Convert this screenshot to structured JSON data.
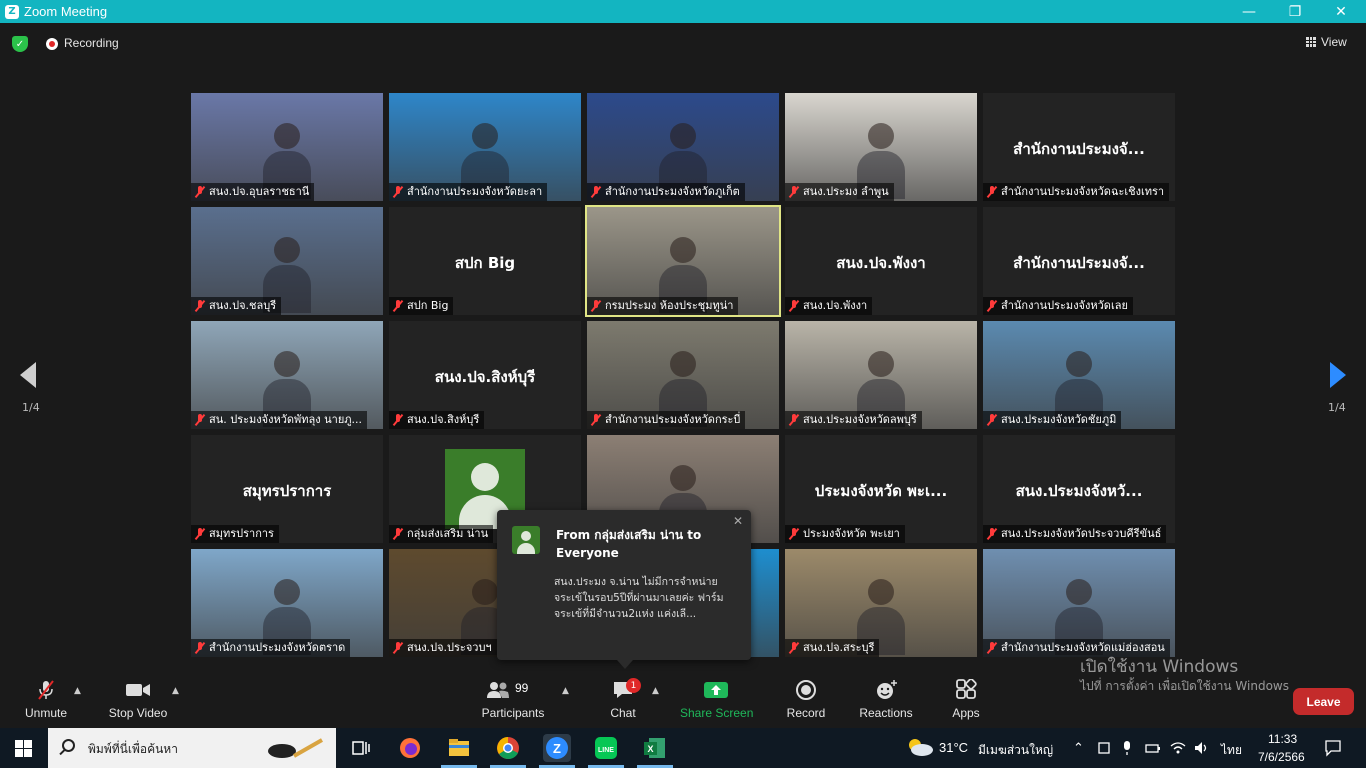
{
  "window": {
    "title": "Zoom Meeting"
  },
  "topbar": {
    "recording_label": "Recording",
    "view_label": "View"
  },
  "tiles": [
    {
      "label": "สนง.ปจ.อุบลราชธานี",
      "type": "video",
      "bg": "#6a78a8",
      "name_center": ""
    },
    {
      "label": "สำนักงานประมงจังหวัดยะลา",
      "type": "video",
      "bg": "#2e86c9",
      "name_center": ""
    },
    {
      "label": "สำนักงานประมงจังหวัดภูเก็ต",
      "type": "video",
      "bg": "#2c4a8c",
      "name_center": ""
    },
    {
      "label": "สนง.ประมง ลำพูน",
      "type": "video",
      "bg": "#d9d6cf",
      "name_center": ""
    },
    {
      "label": "สำนักงานประมงจังหวัดฉะเชิงเทรา",
      "type": "name",
      "bg": "#232323",
      "name_center": "สำนักงานประมงจั..."
    },
    {
      "label": "สนง.ปจ.ชลบุรี",
      "type": "video",
      "bg": "#5a6f8e",
      "name_center": ""
    },
    {
      "label": "สปก Big",
      "type": "name",
      "bg": "#232323",
      "name_center": "สปก Big"
    },
    {
      "label": "กรมประมง ห้องประชุมทูน่า",
      "type": "video",
      "bg": "#9b9689",
      "name_center": ""
    },
    {
      "label": "สนง.ปจ.พังงา",
      "type": "name",
      "bg": "#232323",
      "name_center": "สนง.ปจ.พังงา"
    },
    {
      "label": "สำนักงานประมงจังหวัดเลย",
      "type": "name",
      "bg": "#232323",
      "name_center": "สำนักงานประมงจั..."
    },
    {
      "label": "สน. ประมงจังหวัดพัทลุง นายภู...",
      "type": "video",
      "bg": "#8fa6b8",
      "name_center": ""
    },
    {
      "label": "สนง.ปจ.สิงห์บุรี",
      "type": "name",
      "bg": "#232323",
      "name_center": "สนง.ปจ.สิงห์บุรี"
    },
    {
      "label": "สำนักงานประมงจังหวัดกระบี่",
      "type": "video",
      "bg": "#7d7a6e",
      "name_center": ""
    },
    {
      "label": "สนง.ประมงจังหวัดลพบุรี",
      "type": "video",
      "bg": "#b9b4a8",
      "name_center": ""
    },
    {
      "label": "สนง.ประมงจังหวัดชัยภูมิ",
      "type": "video",
      "bg": "#5b8ab0",
      "name_center": ""
    },
    {
      "label": "สมุทรปราการ",
      "type": "name",
      "bg": "#232323",
      "name_center": "สมุทรปราการ"
    },
    {
      "label": "กลุ่มส่งเสริม น่าน",
      "type": "avatar",
      "bg": "#232323",
      "name_center": ""
    },
    {
      "label": "",
      "type": "video",
      "bg": "#8c7f74",
      "name_center": ""
    },
    {
      "label": "ประมงจังหวัด พะเยา",
      "type": "name",
      "bg": "#232323",
      "name_center": "ประมงจังหวัด พะเ..."
    },
    {
      "label": "สนง.ประมงจังหวัดประจวบคีรีขันธ์",
      "type": "name",
      "bg": "#232323",
      "name_center": "สนง.ประมงจังหวั..."
    },
    {
      "label": "สำนักงานประมงจังหวัดตราด",
      "type": "video",
      "bg": "#7fa7c9",
      "name_center": ""
    },
    {
      "label": "สนง.ปจ.ประจวบฯ",
      "type": "video",
      "bg": "#5e4a2e",
      "name_center": ""
    },
    {
      "label": "งินบุรี",
      "type": "video",
      "bg": "#1e8ecf",
      "name_center": ""
    },
    {
      "label": "สนง.ปจ.สระบุรี",
      "type": "video",
      "bg": "#9c8a6a",
      "name_center": ""
    },
    {
      "label": "สำนักงานประมงจังหวัดแม่ฮ่องสอน",
      "type": "video",
      "bg": "#6f8fb0",
      "name_center": ""
    }
  ],
  "pager": {
    "left": "1/4",
    "right": "1/4"
  },
  "chat_popup": {
    "from": "From กลุ่มส่งเสริม น่าน to Everyone",
    "message": "สนง.ประมง จ.น่าน ไม่มีการจำหน่าย จระเข้ในรอบ5ปีที่ผ่านมาเลยค่ะ ฟาร์ม จระเข้ที่มีจำนวน2แห่ง แค่งเลี..."
  },
  "toolbar": {
    "unmute": "Unmute",
    "stop_video": "Stop Video",
    "participants": "Participants",
    "participants_count": "99",
    "chat": "Chat",
    "chat_badge": "1",
    "share_screen": "Share Screen",
    "record": "Record",
    "reactions": "Reactions",
    "apps": "Apps",
    "leave": "Leave"
  },
  "watermark": {
    "line1": "เปิดใช้งาน Windows",
    "line2": "ไปที่ การตั้งค่า เพื่อเปิดใช้งาน Windows"
  },
  "taskbar": {
    "search_placeholder": "พิมพ์ที่นี่เพื่อค้นหา",
    "weather_temp": "31°C",
    "weather_text": "มีเมฆส่วนใหญ่",
    "language": "ไทย",
    "time": "11:33",
    "date": "7/6/2566"
  },
  "colors": {
    "zoom_accent": "#13b5c1",
    "share_green": "#1fb85a",
    "leave_red": "#c42b2b",
    "active_speaker": "#e0e585"
  }
}
